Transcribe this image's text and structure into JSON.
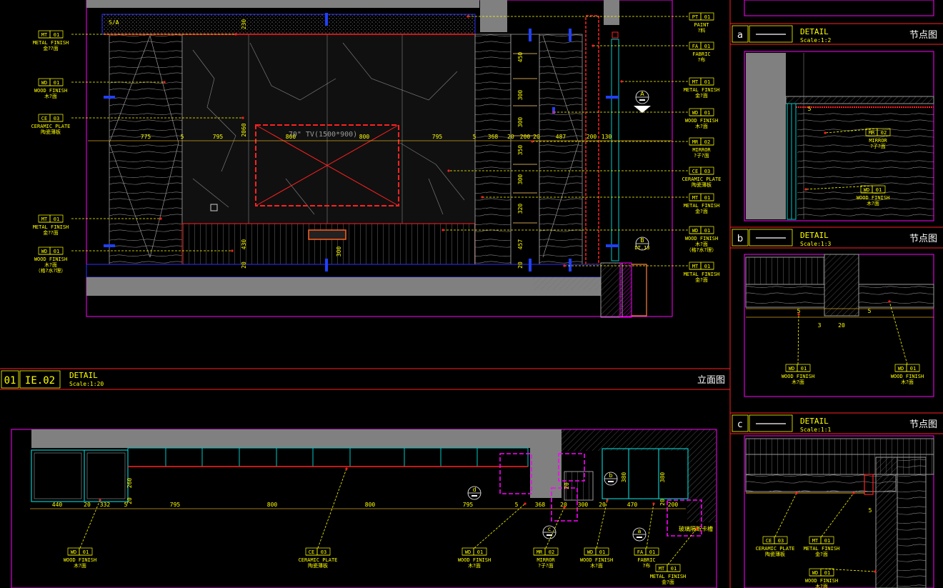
{
  "colors": {
    "background": "#000000",
    "frame": "#ff00ff",
    "title_line": "#ff2020",
    "text": "#ffff00",
    "leader": "#ffff00",
    "wall": "#808080",
    "steel": "#00c8c8",
    "blue": "#2040ff",
    "tv": "#ff2020"
  },
  "main_elevation": {
    "sa_label": "S/A",
    "tv_label": "70\" TV(1500*900)",
    "dims_horizontal": [
      "775",
      "5",
      "795",
      "800",
      "800",
      "795",
      "5",
      "368",
      "20",
      "200",
      "20",
      "487",
      "200",
      "130"
    ],
    "dims_vertical": [
      "230",
      "2060",
      "430",
      "20"
    ],
    "shelf_dims": [
      "450",
      "300",
      "300",
      "350",
      "300",
      "320",
      "457",
      "20"
    ],
    "inner_dims": [
      "300"
    ],
    "section_a": "A",
    "section_b": "B",
    "section_b_ref": "DT.13",
    "tags_left": [
      {
        "code": "MT",
        "num": "01",
        "l1": "METAL FINISH",
        "l2": "金??面"
      },
      {
        "code": "WD",
        "num": "01",
        "l1": "WOOD FINISH",
        "l2": "木?面"
      },
      {
        "code": "CE",
        "num": "03",
        "l1": "CERAMIC PLATE",
        "l2": "陶瓷薄板"
      },
      {
        "code": "MT",
        "num": "01",
        "l1": "METAL FINISH",
        "l2": "金??面"
      },
      {
        "code": "WD",
        "num": "01",
        "l1": "WOOD FINISH",
        "l2": "木?面",
        "l3": "（格?水?理）"
      }
    ],
    "tags_right": [
      {
        "code": "PT",
        "num": "01",
        "l1": "PAINT",
        "l2": "?料"
      },
      {
        "code": "FA",
        "num": "01",
        "l1": "FABRIC",
        "l2": "?布"
      },
      {
        "code": "MT",
        "num": "01",
        "l1": "METAL FINISH",
        "l2": "金?面"
      },
      {
        "code": "WD",
        "num": "01",
        "l1": "WOOD FINISH",
        "l2": "木?面"
      },
      {
        "code": "MR",
        "num": "02",
        "l1": "MIRROR",
        "l2": "?子?面"
      },
      {
        "code": "CE",
        "num": "03",
        "l1": "CERAMIC PLATE",
        "l2": "陶瓷薄板"
      },
      {
        "code": "MT",
        "num": "01",
        "l1": "METAL FINISH",
        "l2": "金?面"
      },
      {
        "code": "WD",
        "num": "01",
        "l1": "WOOD FINISH",
        "l2": "木?面",
        "l3": "（格?水?理）"
      },
      {
        "code": "MT",
        "num": "01",
        "l1": "METAL FINISH",
        "l2": "金?面"
      }
    ]
  },
  "title_main": {
    "num": "01",
    "ref": "IE.02",
    "title": "DETAIL",
    "scale": "Scale:1:20",
    "cn": "立面图"
  },
  "details": [
    {
      "letter": "a",
      "title": "DETAIL",
      "scale": "Scale:1:2",
      "cn": "节点图",
      "tags": [
        {
          "code": "MR",
          "num": "02",
          "l1": "MIRROR",
          "l2": "?子?面"
        },
        {
          "code": "WD",
          "num": "01",
          "l1": "WOOD FINISH",
          "l2": "木?面"
        }
      ],
      "dims": [
        "5"
      ]
    },
    {
      "letter": "b",
      "title": "DETAIL",
      "scale": "Scale:1:3",
      "cn": "节点图",
      "tags": [
        {
          "code": "WD",
          "num": "01",
          "l1": "WOOD FINISH",
          "l2": "木?面"
        },
        {
          "code": "WD",
          "num": "01",
          "l1": "WOOD FINISH",
          "l2": "木?面"
        }
      ],
      "dims": [
        "5",
        "3",
        "20",
        "5"
      ]
    },
    {
      "letter": "c",
      "title": "DETAIL",
      "scale": "Scale:1:1",
      "cn": "节点图",
      "tags": [
        {
          "code": "CE",
          "num": "03",
          "l1": "CERAMIC PLATE",
          "l2": "陶瓷薄板"
        },
        {
          "code": "MT",
          "num": "01",
          "l1": "METAL FINISH",
          "l2": "金?面"
        },
        {
          "code": "WD",
          "num": "01",
          "l1": "WOOD FINISH",
          "l2": "木?面"
        }
      ],
      "dims": [
        "5"
      ]
    }
  ],
  "plan": {
    "dims": [
      "440",
      "20",
      "332",
      "5",
      "795",
      "800",
      "800",
      "795",
      "5",
      "368",
      "20",
      "300",
      "20",
      "470",
      "200"
    ],
    "dims_vertical": [
      "260",
      "20",
      "380",
      "380",
      "20",
      "20"
    ],
    "bubbles": [
      "d",
      "c",
      "b",
      "a"
    ],
    "note": "玻璃隔断卡槽",
    "tags": [
      {
        "code": "WD",
        "num": "01",
        "l1": "WOOD FINISH",
        "l2": "木?面"
      },
      {
        "code": "CE",
        "num": "03",
        "l1": "CERAMIC PLATE",
        "l2": "陶瓷薄板"
      },
      {
        "code": "WD",
        "num": "01",
        "l1": "WOOD FINISH",
        "l2": "木?面"
      },
      {
        "code": "MR",
        "num": "02",
        "l1": "MIRROR",
        "l2": "?子?面"
      },
      {
        "code": "WD",
        "num": "01",
        "l1": "WOOD FINISH",
        "l2": "木?面"
      },
      {
        "code": "FA",
        "num": "01",
        "l1": "FABRIC",
        "l2": "?布"
      },
      {
        "code": "MT",
        "num": "01",
        "l1": "METAL FINISH",
        "l2": "金?面"
      }
    ]
  }
}
